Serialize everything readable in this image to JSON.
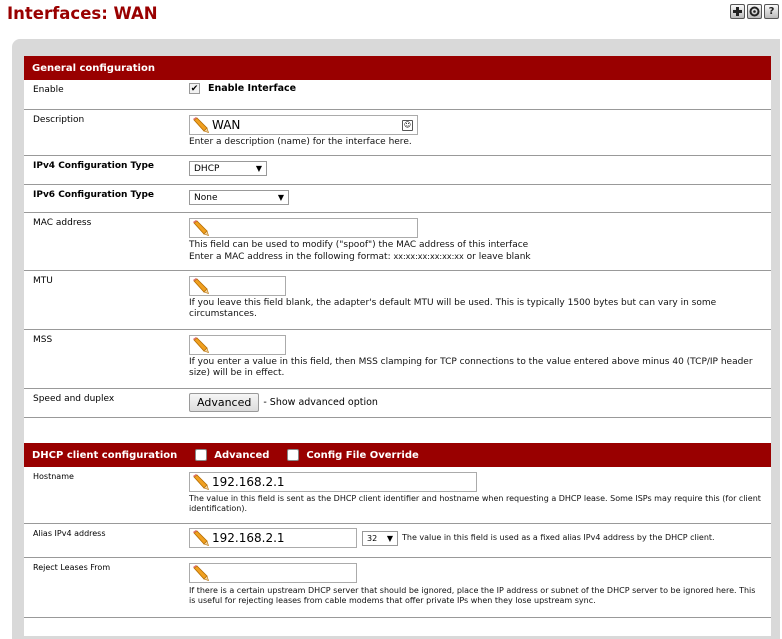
{
  "page": {
    "title": "Interfaces: WAN"
  },
  "top_icons": [
    "add-icon",
    "settings-icon",
    "help-icon"
  ],
  "colors": {
    "title": "#990000",
    "section_header": "#990000",
    "panel_bg": "#d9d9d9"
  },
  "general": {
    "header": "General configuration",
    "enable": {
      "label": "Enable",
      "checkbox_label": "Enable Interface",
      "checked": true
    },
    "description": {
      "label": "Description",
      "value": "WAN",
      "help": "Enter a description (name) for the interface here."
    },
    "ipv4_type": {
      "label": "IPv4 Configuration Type",
      "value": "DHCP"
    },
    "ipv6_type": {
      "label": "IPv6 Configuration Type",
      "value": "None"
    },
    "mac": {
      "label": "MAC address",
      "value": "",
      "help1": "This field can be used to modify (\"spoof\") the MAC address of this interface",
      "help2_prefix": "Enter a MAC address in the following format: ",
      "help2_format": "xx:xx:xx:xx:xx:xx",
      "help2_suffix": " or leave blank"
    },
    "mtu": {
      "label": "MTU",
      "value": "",
      "help": "If you leave this field blank, the adapter's default MTU will be used. This is typically 1500 bytes but can vary in some circumstances."
    },
    "mss": {
      "label": "MSS",
      "value": "",
      "help": "If you enter a value in this field, then MSS clamping for TCP connections to the value entered above minus 40 (TCP/IP header size) will be in effect."
    },
    "speed": {
      "label": "Speed and duplex",
      "button": "Advanced",
      "note": "- Show advanced option"
    }
  },
  "dhcp": {
    "header": "DHCP client configuration",
    "opt_advanced": "Advanced",
    "opt_override": "Config File Override",
    "hostname": {
      "label": "Hostname",
      "value": "192.168.2.1",
      "help": "The value in this field is sent as the DHCP client identifier and hostname when requesting a DHCP lease. Some ISPs may require this (for client identification)."
    },
    "alias": {
      "label": "Alias IPv4 address",
      "value": "192.168.2.1",
      "mask": "32",
      "help": "The value in this field is used as a fixed alias IPv4 address by the DHCP client."
    },
    "reject": {
      "label": "Reject Leases From",
      "value": "",
      "help": "If there is a certain upstream DHCP server that should be ignored, place the IP address or subnet of the DHCP server to be ignored here. This is useful for rejecting leases from cable modems that offer private IPs when they lose upstream sync."
    }
  }
}
